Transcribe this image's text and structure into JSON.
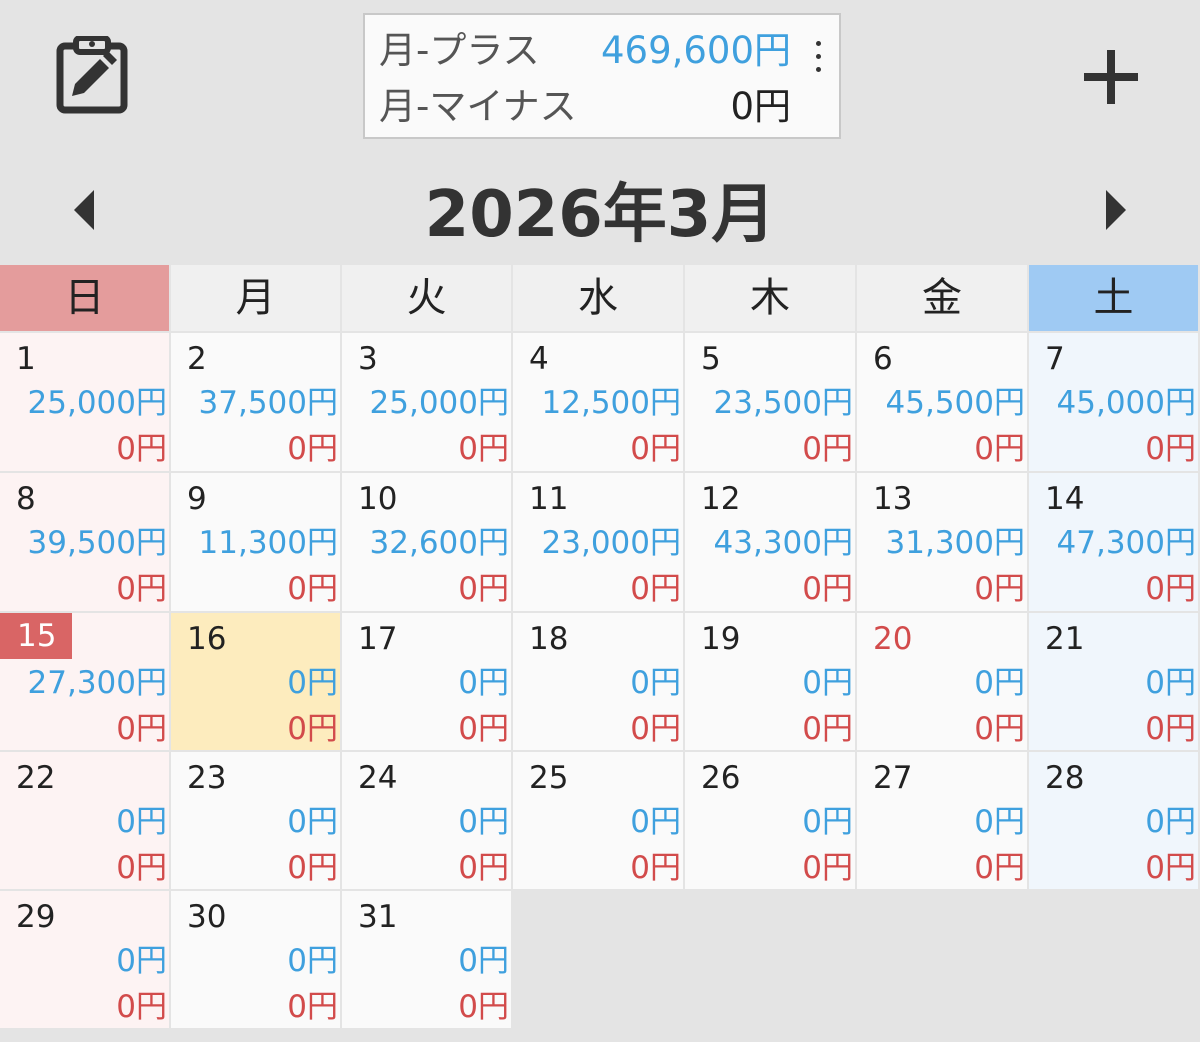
{
  "summary": {
    "plus_label": "月-プラス",
    "plus_value": "469,600円",
    "minus_label": "月-マイナス",
    "minus_value": "0円"
  },
  "calendar": {
    "title": "2026年3月",
    "weekdays": [
      "日",
      "月",
      "火",
      "水",
      "木",
      "金",
      "土"
    ],
    "days": [
      {
        "day": "1",
        "plus": "25,000円",
        "minus": "0円"
      },
      {
        "day": "2",
        "plus": "37,500円",
        "minus": "0円"
      },
      {
        "day": "3",
        "plus": "25,000円",
        "minus": "0円"
      },
      {
        "day": "4",
        "plus": "12,500円",
        "minus": "0円"
      },
      {
        "day": "5",
        "plus": "23,500円",
        "minus": "0円"
      },
      {
        "day": "6",
        "plus": "45,500円",
        "minus": "0円"
      },
      {
        "day": "7",
        "plus": "45,000円",
        "minus": "0円"
      },
      {
        "day": "8",
        "plus": "39,500円",
        "minus": "0円"
      },
      {
        "day": "9",
        "plus": "11,300円",
        "minus": "0円"
      },
      {
        "day": "10",
        "plus": "32,600円",
        "minus": "0円"
      },
      {
        "day": "11",
        "plus": "23,000円",
        "minus": "0円"
      },
      {
        "day": "12",
        "plus": "43,300円",
        "minus": "0円"
      },
      {
        "day": "13",
        "plus": "31,300円",
        "minus": "0円"
      },
      {
        "day": "14",
        "plus": "47,300円",
        "minus": "0円"
      },
      {
        "day": "15",
        "plus": "27,300円",
        "minus": "0円",
        "marked": true
      },
      {
        "day": "16",
        "plus": "0円",
        "minus": "0円",
        "today": true
      },
      {
        "day": "17",
        "plus": "0円",
        "minus": "0円"
      },
      {
        "day": "18",
        "plus": "0円",
        "minus": "0円"
      },
      {
        "day": "19",
        "plus": "0円",
        "minus": "0円"
      },
      {
        "day": "20",
        "plus": "0円",
        "minus": "0円",
        "holiday": true
      },
      {
        "day": "21",
        "plus": "0円",
        "minus": "0円"
      },
      {
        "day": "22",
        "plus": "0円",
        "minus": "0円"
      },
      {
        "day": "23",
        "plus": "0円",
        "minus": "0円"
      },
      {
        "day": "24",
        "plus": "0円",
        "minus": "0円"
      },
      {
        "day": "25",
        "plus": "0円",
        "minus": "0円"
      },
      {
        "day": "26",
        "plus": "0円",
        "minus": "0円"
      },
      {
        "day": "27",
        "plus": "0円",
        "minus": "0円"
      },
      {
        "day": "28",
        "plus": "0円",
        "minus": "0円"
      },
      {
        "day": "29",
        "plus": "0円",
        "minus": "0円"
      },
      {
        "day": "30",
        "plus": "0円",
        "minus": "0円"
      },
      {
        "day": "31",
        "plus": "0円",
        "minus": "0円"
      }
    ]
  },
  "icons": {
    "edit": "clipboard-edit-icon",
    "add": "plus-icon",
    "more": "kebab-icon",
    "prev": "triangle-left-icon",
    "next": "triangle-right-icon"
  },
  "colors": {
    "plus": "#3fa0de",
    "minus": "#d24b4b",
    "sunday_header": "#e49c9c",
    "saturday_header": "#9fcaf3",
    "today": "#fdecbe",
    "marked_day": "#d96565"
  }
}
